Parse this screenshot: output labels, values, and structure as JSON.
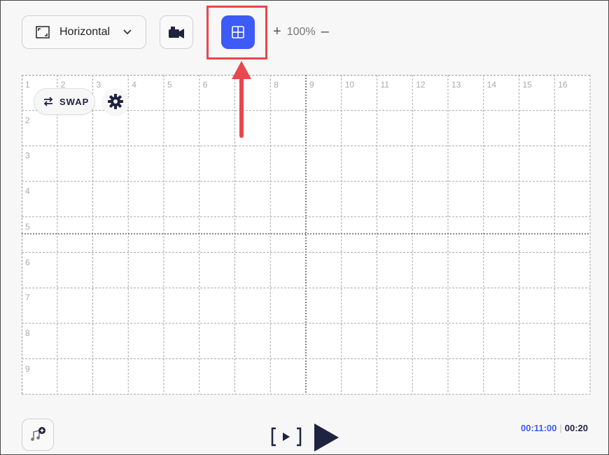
{
  "toolbar": {
    "orientation_label": "Horizontal",
    "zoom_plus": "+",
    "zoom_value": "100%",
    "zoom_minus": "–"
  },
  "canvas": {
    "column_labels": [
      "1",
      "2",
      "3",
      "4",
      "5",
      "6",
      "7",
      "8",
      "9",
      "10",
      "11",
      "12",
      "13",
      "14",
      "15",
      "16"
    ],
    "row_labels": [
      "2",
      "3",
      "4",
      "5",
      "6",
      "7",
      "8",
      "9"
    ]
  },
  "swap_label": "SWAP",
  "playback": {
    "current_time": "00:11:00",
    "separator": "|",
    "total_time": "00:20"
  },
  "colors": {
    "accent": "#3d5bf6",
    "highlight": "#e8474b",
    "dark": "#1e2340"
  },
  "icons": {
    "orientation": "aspect-ratio-icon",
    "dropdown": "chevron-down-icon",
    "camera": "video-camera-icon",
    "grid": "grid-icon",
    "swap": "swap-arrows-icon",
    "settings": "gear-icon",
    "music": "music-add-icon",
    "preview": "bracket-play-icon",
    "play": "play-icon"
  }
}
